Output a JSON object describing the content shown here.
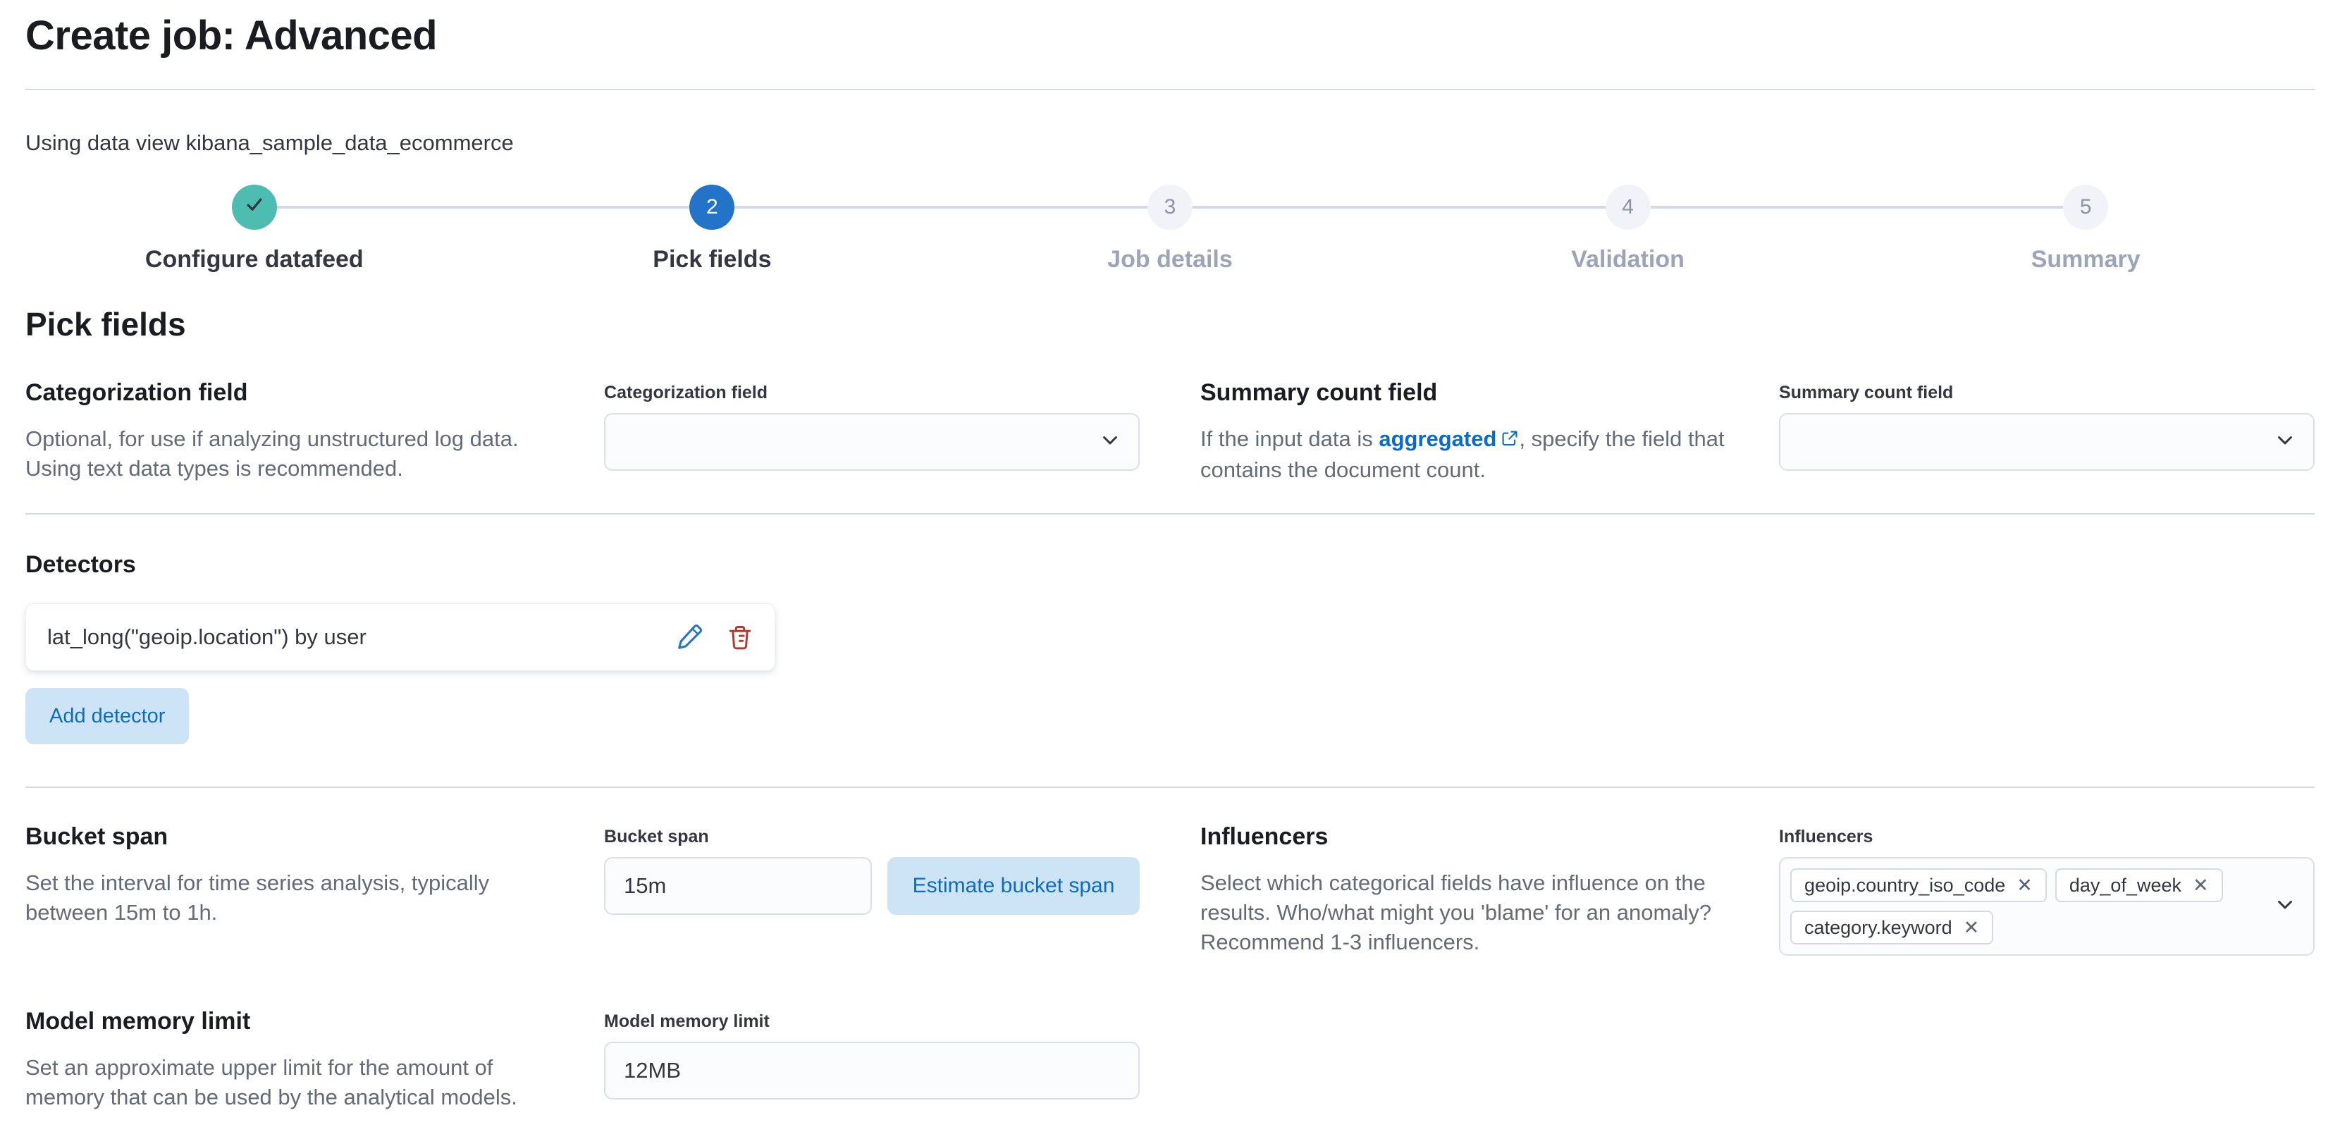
{
  "page": {
    "title": "Create job: Advanced",
    "data_view_text": "Using data view kibana_sample_data_ecommerce",
    "heading": "Pick fields"
  },
  "steps": [
    {
      "number": "1",
      "label": "Configure datafeed",
      "status": "complete"
    },
    {
      "number": "2",
      "label": "Pick fields",
      "status": "current"
    },
    {
      "number": "3",
      "label": "Job details",
      "status": "incomplete"
    },
    {
      "number": "4",
      "label": "Validation",
      "status": "incomplete"
    },
    {
      "number": "5",
      "label": "Summary",
      "status": "incomplete"
    }
  ],
  "categorization": {
    "title": "Categorization field",
    "description": "Optional, for use if analyzing unstructured log data. Using text data types is recommended.",
    "field_label": "Categorization field",
    "value": ""
  },
  "summary_count": {
    "title": "Summary count field",
    "desc_before_link": "If the input data is ",
    "link_text": "aggregated",
    "desc_after_link": ", specify the field that contains the document count.",
    "field_label": "Summary count field",
    "value": ""
  },
  "detectors": {
    "title": "Detectors",
    "items": [
      {
        "text": "lat_long(\"geoip.location\") by user"
      }
    ],
    "add_button_label": "Add detector"
  },
  "bucket_span": {
    "title": "Bucket span",
    "description": "Set the interval for time series analysis, typically between 15m to 1h.",
    "field_label": "Bucket span",
    "value": "15m",
    "estimate_button_label": "Estimate bucket span"
  },
  "influencers": {
    "title": "Influencers",
    "description": "Select which categorical fields have influence on the results. Who/what might you 'blame' for an anomaly? Recommend 1-3 influencers.",
    "field_label": "Influencers",
    "tags": [
      {
        "label": "geoip.country_iso_code"
      },
      {
        "label": "day_of_week"
      },
      {
        "label": "category.keyword"
      }
    ],
    "remove_glyph": "✕"
  },
  "model_memory": {
    "title": "Model memory limit",
    "description": "Set an approximate upper limit for the amount of memory that can be used by the analytical models.",
    "field_label": "Model memory limit",
    "value": "12MB"
  },
  "colors": {
    "step_complete": "#4dbdb2",
    "step_current": "#2373c9",
    "link_blue": "#0b6bcb",
    "edit_blue": "#2474c8",
    "delete_red": "#b43a2d",
    "button_bg": "#cce4f5",
    "button_text": "#0e6cc0",
    "divider": "#d3dae6"
  }
}
